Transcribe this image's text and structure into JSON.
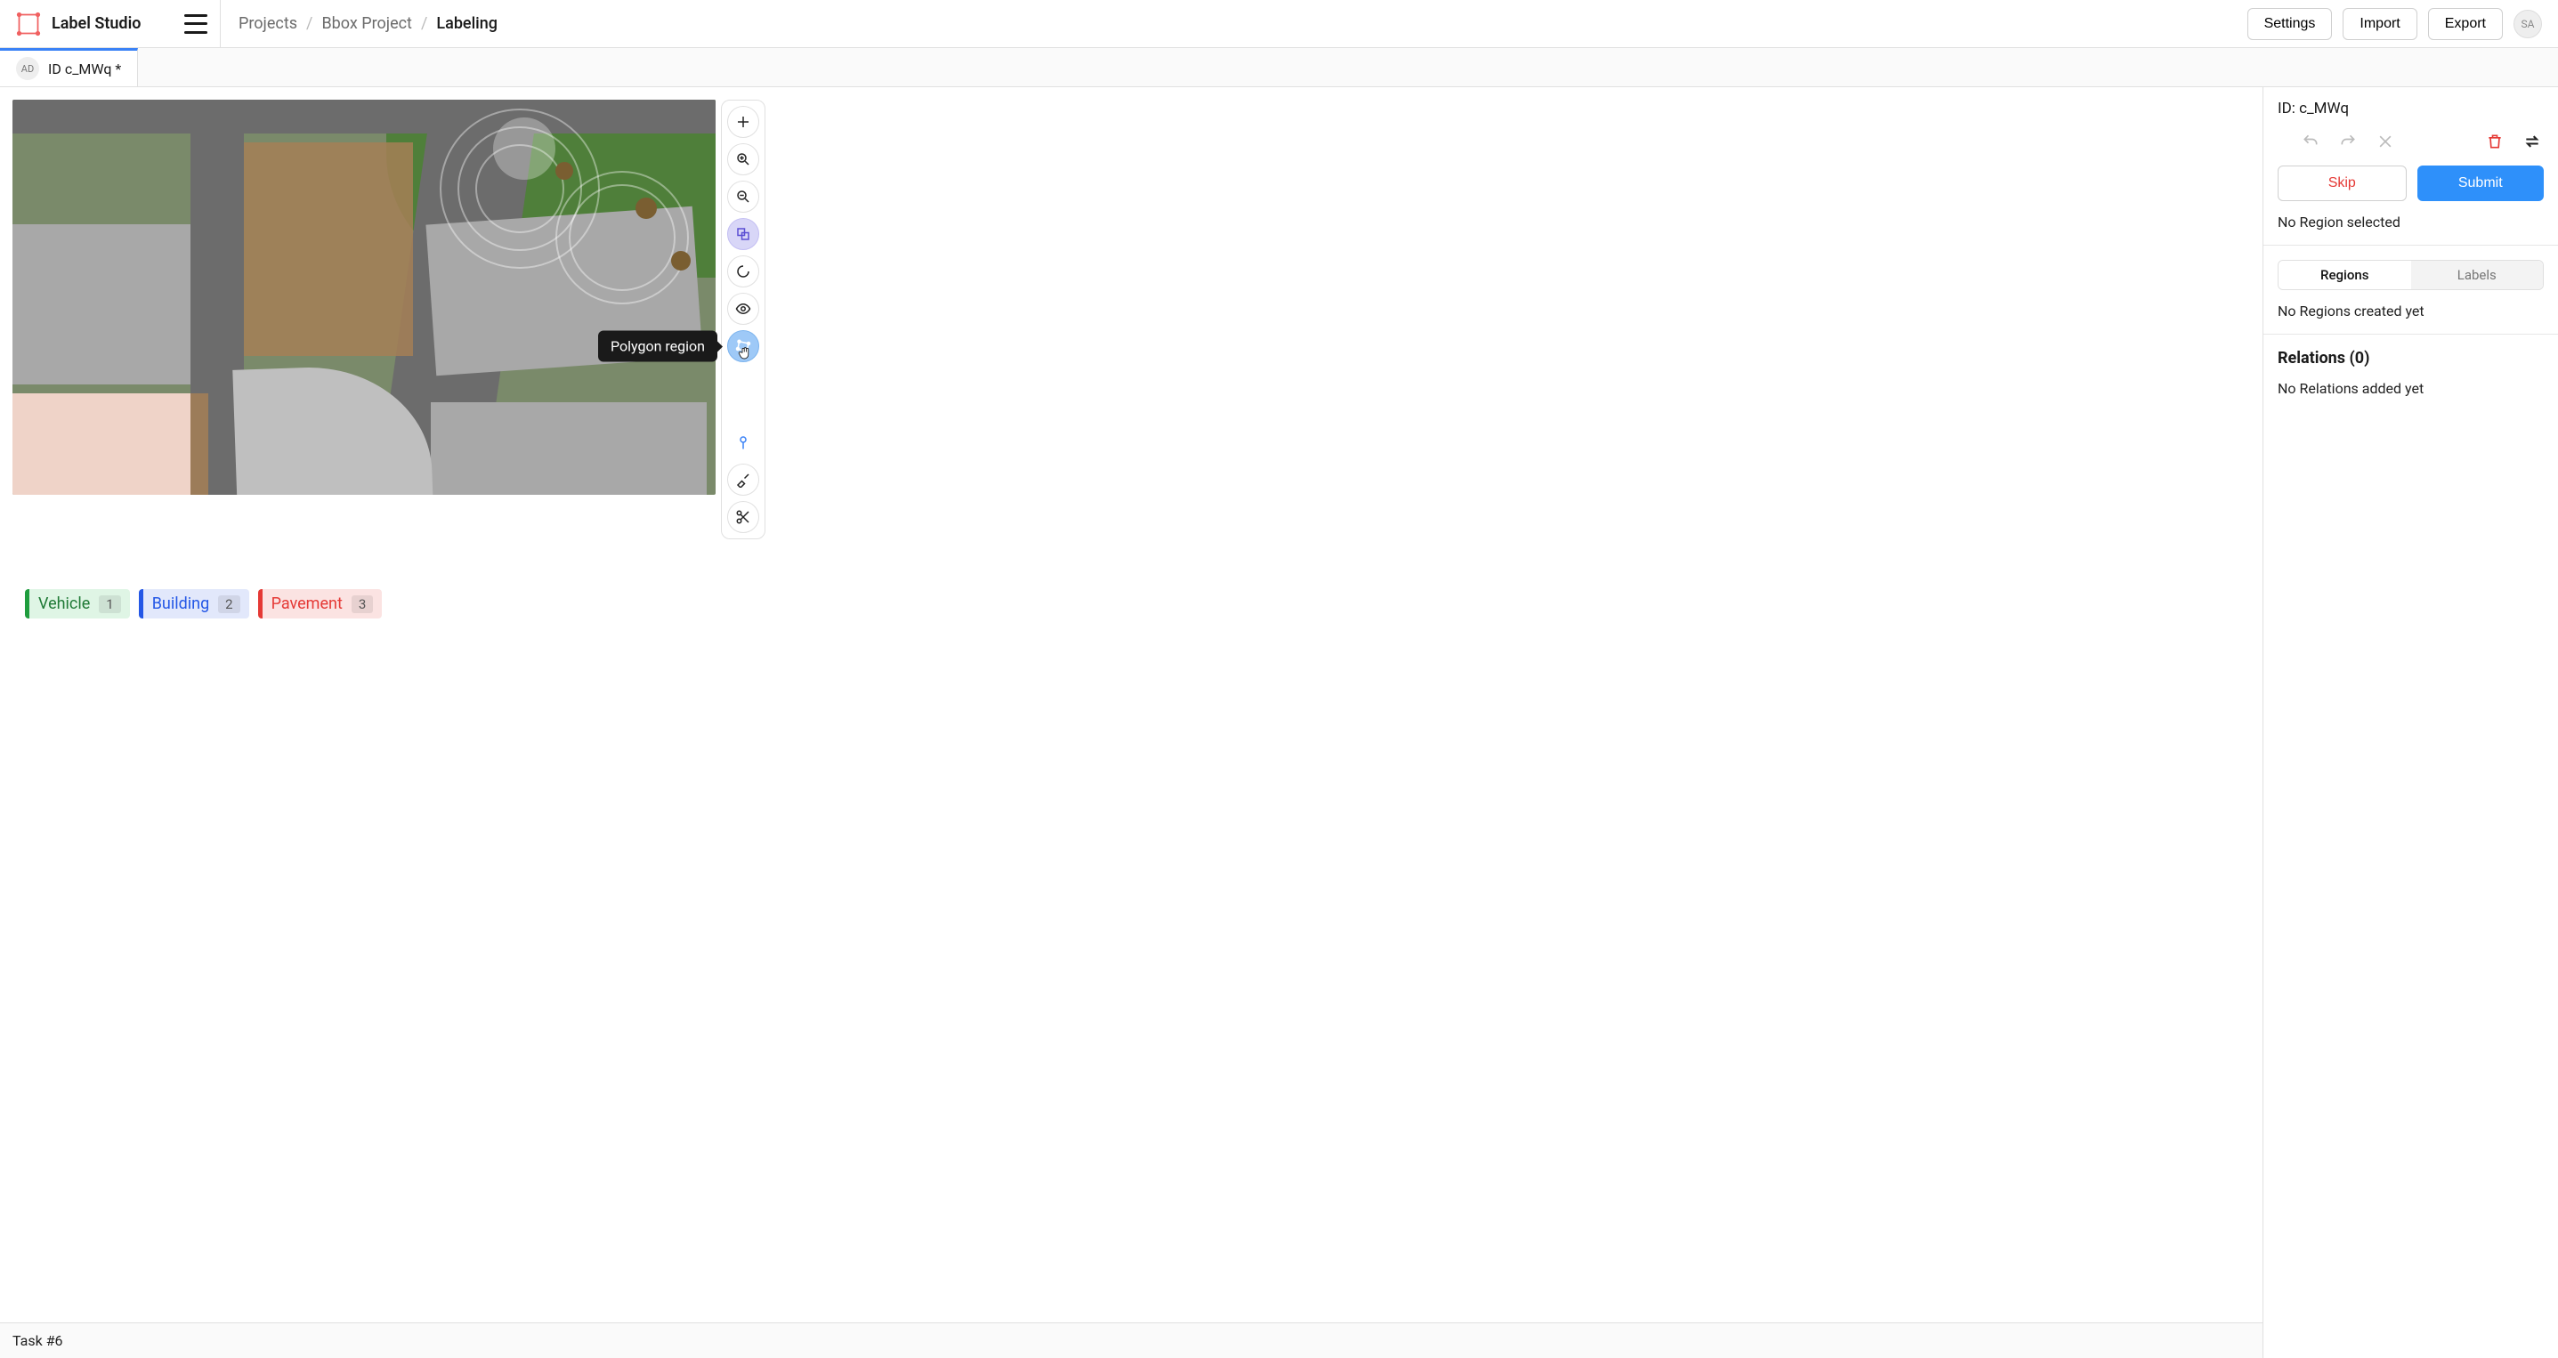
{
  "header": {
    "app_name": "Label Studio",
    "breadcrumb": {
      "root": "Projects",
      "project": "Bbox Project",
      "current": "Labeling"
    },
    "actions": {
      "settings": "Settings",
      "import": "Import",
      "export": "Export"
    },
    "avatar_initials": "SA"
  },
  "tab": {
    "badge": "AD",
    "title": "ID c_MWq *"
  },
  "toolbar": {
    "tooltip": "Polygon region"
  },
  "labels": [
    {
      "name": "Vehicle",
      "hotkey": "1",
      "color": "green"
    },
    {
      "name": "Building",
      "hotkey": "2",
      "color": "blue"
    },
    {
      "name": "Pavement",
      "hotkey": "3",
      "color": "red"
    }
  ],
  "footer": {
    "task": "Task #6"
  },
  "sidebar": {
    "id_label": "ID: c_MWq",
    "skip": "Skip",
    "submit": "Submit",
    "no_region": "No Region selected",
    "tabs": {
      "regions": "Regions",
      "labels": "Labels"
    },
    "no_regions_msg": "No Regions created yet",
    "relations_heading": "Relations (0)",
    "no_relations_msg": "No Relations added yet"
  }
}
